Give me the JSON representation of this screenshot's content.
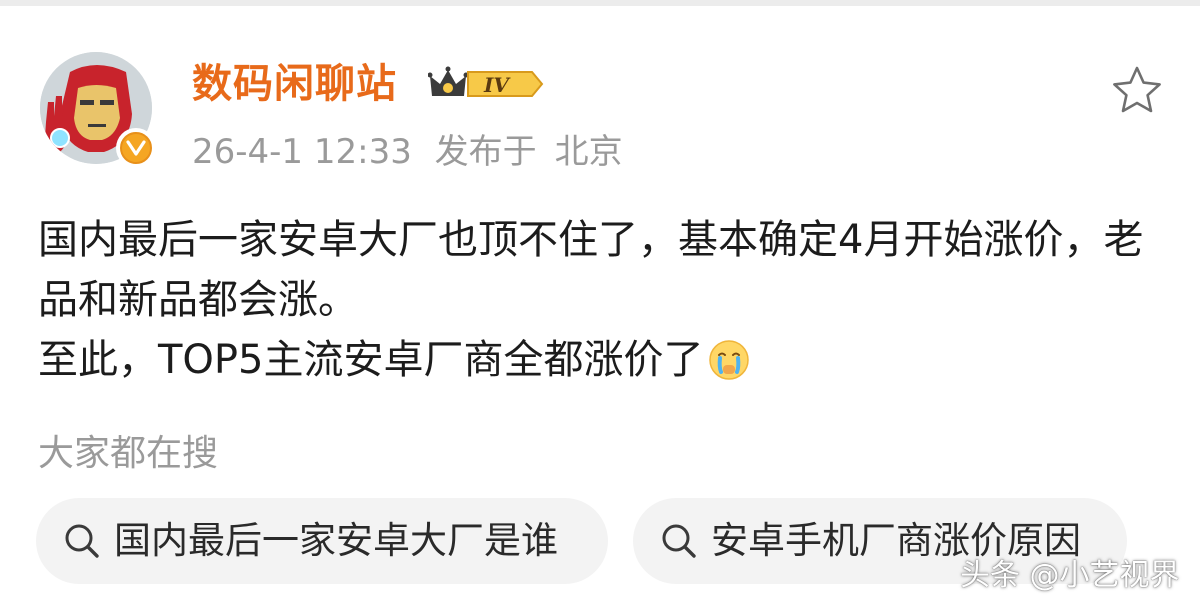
{
  "post": {
    "author": {
      "name": "数码闲聊站",
      "level": "IV",
      "avatar_icon": "ironman-avatar-icon",
      "verified_icon": "verified-v-icon"
    },
    "timestamp": "26-4-1 12:33",
    "published_label": "发布于",
    "location": "北京",
    "favorite_icon": "star-outline-icon",
    "text_lines": [
      "国内最后一家安卓大厂也顶不住了，基本确定4月开始涨价，老品和新品都会涨。",
      "至此，TOP5主流安卓厂商全都涨价了"
    ],
    "emoji": "crying-emoji-icon"
  },
  "trending": {
    "heading": "大家都在搜",
    "chips": [
      {
        "label": "国内最后一家安卓大厂是谁",
        "icon": "search-icon"
      },
      {
        "label": "安卓手机厂商涨价原因",
        "icon": "search-icon"
      }
    ]
  },
  "watermark": "头条 @小艺视界",
  "colors": {
    "username": "#e86a1a",
    "meta": "#9a9a9a",
    "chip_bg": "#f3f3f3",
    "verified": "#f5a623"
  }
}
